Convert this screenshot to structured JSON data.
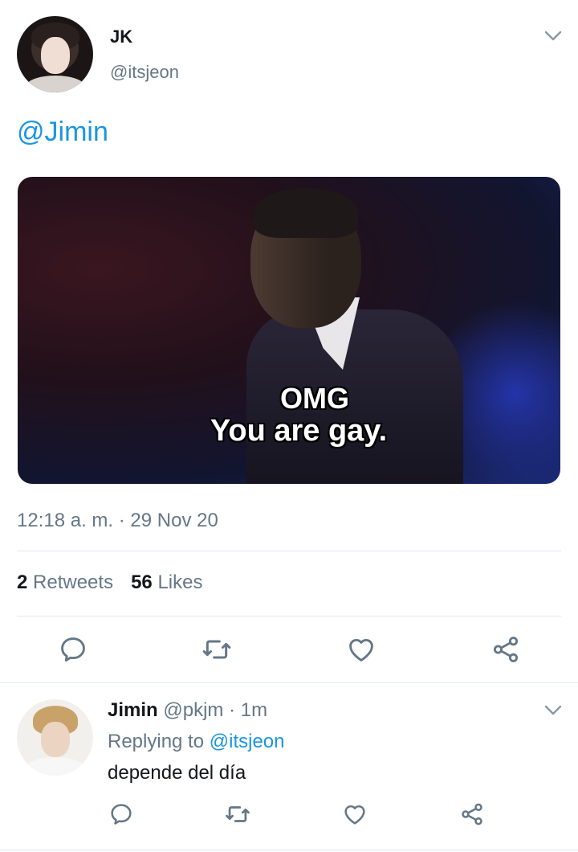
{
  "tweet": {
    "author_name": "JK",
    "author_handle": "@itsjeon",
    "text_mention": "@Jimin",
    "media": {
      "caption_line1": "OMG",
      "caption_line2": "You are gay."
    },
    "timestamp": "12:18 a. m. · 29 Nov 20",
    "stats": {
      "retweets_count": "2",
      "retweets_label": "Retweets",
      "likes_count": "56",
      "likes_label": "Likes"
    },
    "actions": [
      "reply-icon",
      "retweet-icon",
      "like-icon",
      "share-icon"
    ]
  },
  "reply": {
    "author_name": "Jimin",
    "author_handle": "@pkjm",
    "time": "· 1m",
    "replying_prefix": "Replying to",
    "replying_to": "@itsjeon",
    "text": "depende del día",
    "actions": [
      "reply-icon",
      "retweet-icon",
      "like-icon",
      "share-icon"
    ]
  },
  "colors": {
    "link": "#1b95e0",
    "secondary_text": "#657786",
    "primary_text": "#14171a",
    "divider": "#e1e8ed"
  }
}
